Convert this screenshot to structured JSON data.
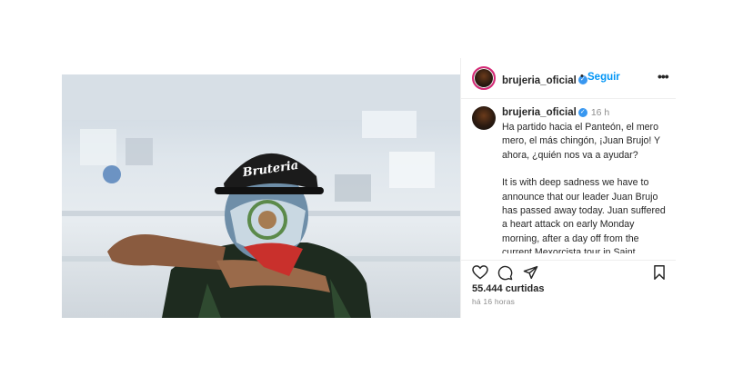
{
  "post": {
    "username": "brujeria_oficial",
    "follow_label": "Seguir",
    "separator": "•",
    "more_label": "•••",
    "caption_time": "16 h",
    "caption_paragraph_1": "Ha partido hacia el Panteón, el mero mero, el más chingón, ¡Juan Brujo! Y ahora, ¿quién nos va a ayudar?",
    "caption_paragraph_2": "It is with deep sadness we have to announce that our leader Juan Brujo has passed away today. Juan suffered a heart attack on early Monday morning, after a day off from the current Mexorcista tour in Saint Clairsville, Ohio. He was rushed to the",
    "likes": "55.444 curtidas",
    "posted_ago": "há 16 horas",
    "cap_text": "Bruteria"
  },
  "icons": {
    "like": "heart-icon",
    "comment": "comment-icon",
    "share": "share-icon",
    "save": "bookmark-icon",
    "verified": "verified-badge-icon"
  },
  "colors": {
    "link": "#0095f6",
    "verified": "#3897f0",
    "story_ring": "#d62976",
    "muted": "#8e8e8e"
  }
}
